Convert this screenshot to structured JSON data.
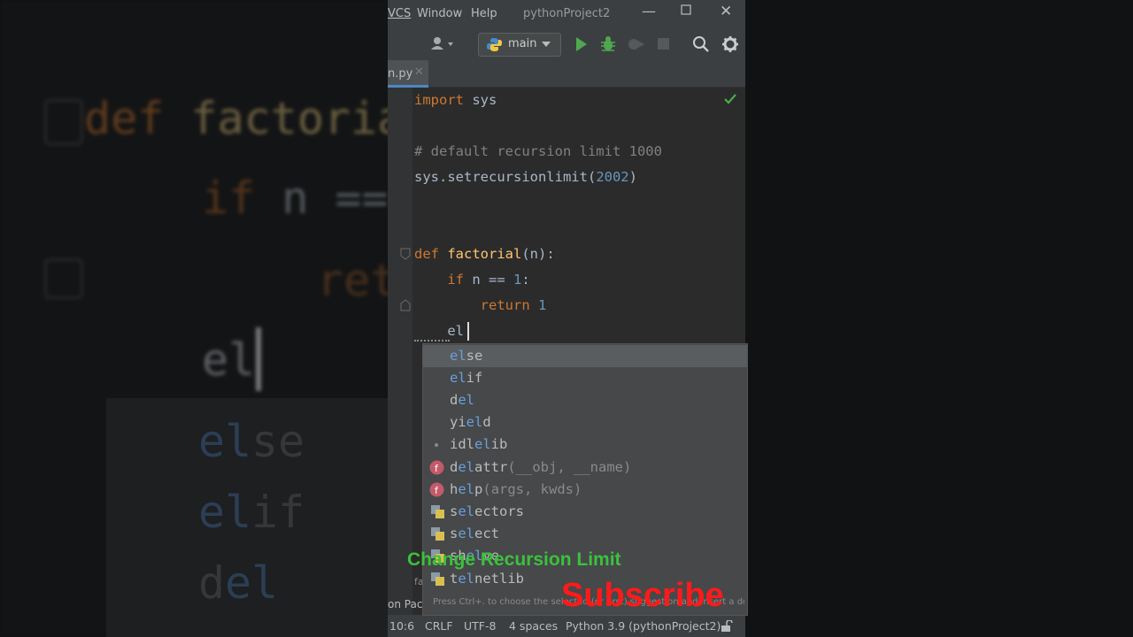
{
  "menu": {
    "items": [
      "VCS",
      "Window",
      "Help"
    ],
    "project_title": "pythonProject2"
  },
  "toolbar": {
    "run_config": "main"
  },
  "tab": {
    "name": "n.py"
  },
  "code": {
    "line1_kw": "import",
    "line1_rest": " sys",
    "line2_comment": "# default recursion limit 1000",
    "line3_call": "sys.setrecursionlimit(",
    "line3_num": "2002",
    "line3_end": ")",
    "line4_kw": "def",
    "line4_fn": "factorial",
    "line4_rest": "(n):",
    "line5_kw": "if",
    "line5_rest": " n == ",
    "line5_num": "1",
    "line5_end": ":",
    "line6_kw": "return",
    "line6_num": "1",
    "line7_typed": "el"
  },
  "completion": {
    "items": [
      {
        "pre": "",
        "match": "el",
        "post": "se",
        "sig": ""
      },
      {
        "pre": "",
        "match": "el",
        "post": "if",
        "sig": ""
      },
      {
        "pre": "d",
        "match": "el",
        "post": "",
        "sig": ""
      },
      {
        "pre": "yi",
        "match": "el",
        "post": "d",
        "sig": ""
      },
      {
        "pre": "idl",
        "match": "el",
        "post": "ib",
        "sig": ""
      },
      {
        "pre": "d",
        "match": "el",
        "post": "attr",
        "sig": "(__obj, __name)"
      },
      {
        "pre": "h",
        "match": "el",
        "post": "p",
        "sig": "(args, kwds)"
      },
      {
        "pre": "s",
        "match": "el",
        "post": "ectors",
        "sig": ""
      },
      {
        "pre": "s",
        "match": "el",
        "post": "ect",
        "sig": ""
      },
      {
        "pre": "sh",
        "match": "el",
        "post": "ve",
        "sig": ""
      },
      {
        "pre": "t",
        "match": "el",
        "post": "netlib",
        "sig": ""
      }
    ],
    "hint": "Press Ctrl+. to choose the selected (or first) suggestion and insert a dot afterwards"
  },
  "bottom_tool": {
    "label": "on Pack"
  },
  "status": {
    "position": "10:6",
    "line_sep": "CRLF",
    "encoding": "UTF-8",
    "indent": "4 spaces",
    "interpreter": "Python 3.9 (pythonProject2)"
  },
  "overlay": {
    "title": "Change Recursion Limit",
    "subscribe": "Subscribe"
  },
  "colors": {
    "keyword": "#cc7832",
    "function": "#ffc66d",
    "number": "#6897bb",
    "comment": "#808080",
    "match": "#6a9fdc",
    "caption_green": "#3cc13c",
    "subscribe_red": "#ff1a1a"
  }
}
